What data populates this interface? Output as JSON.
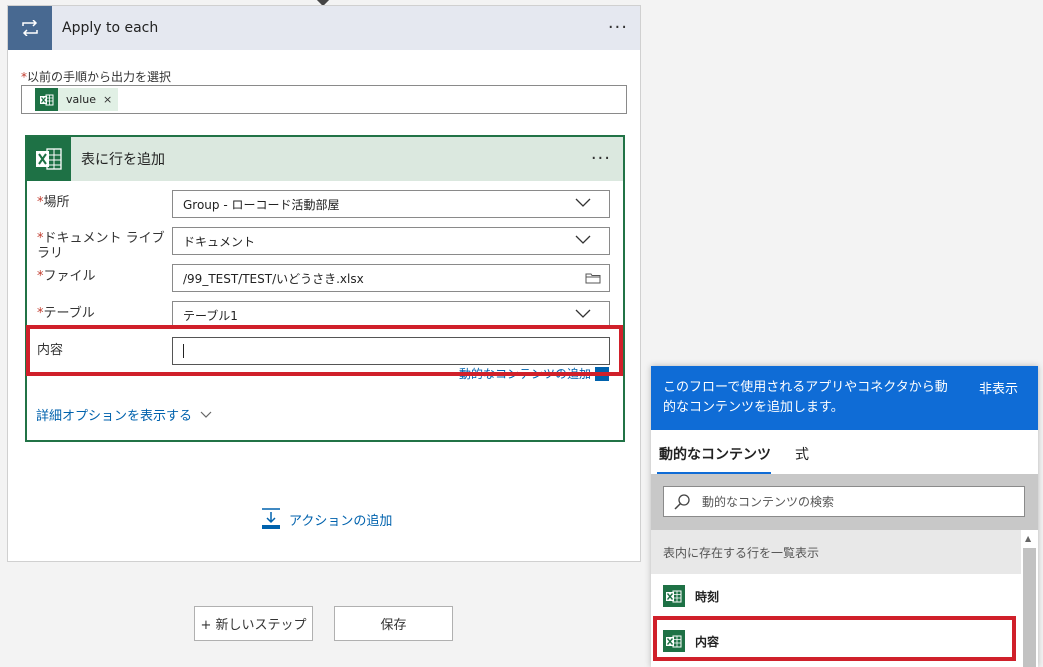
{
  "loop": {
    "title": "Apply to each",
    "more": "···",
    "required_mark": "*",
    "output_label": "以前の手順から出力を選択",
    "token_text": "value",
    "token_remove": "×"
  },
  "action": {
    "title": "表に行を追加",
    "more": "···",
    "fields": {
      "location_label": "場所",
      "location_value": "Group - ローコード活動部屋",
      "library_label_1": "ドキュメント ライブ",
      "library_label_2": "ラリ",
      "library_value": "ドキュメント",
      "file_label": "ファイル",
      "file_value": "/99_TEST/TEST/いどうさき.xlsx",
      "table_label": "テーブル",
      "table_value": "テーブル1",
      "content_label": "内容",
      "content_value": ""
    },
    "dynamic_link": "動的なコンテンツの追加",
    "advanced_link": "詳細オプションを表示する"
  },
  "add_action": "アクションの追加",
  "buttons": {
    "new_step": "+ 新しいステップ",
    "save": "保存"
  },
  "panel": {
    "description": "このフローで使用されるアプリやコネクタから動的なコンテンツを追加します。",
    "hide": "非表示",
    "tab_dynamic": "動的なコンテンツ",
    "tab_expression": "式",
    "search_placeholder": "動的なコンテンツの検索",
    "section_title": "表内に存在する行を一覧表示",
    "items": [
      {
        "label": "時刻"
      },
      {
        "label": "内容"
      }
    ]
  },
  "colors": {
    "loop_accent": "#486991",
    "excel_green": "#1e7145",
    "highlight_red": "#d0202a",
    "panel_blue": "#0f6cd6",
    "link_blue": "#0062ad"
  }
}
